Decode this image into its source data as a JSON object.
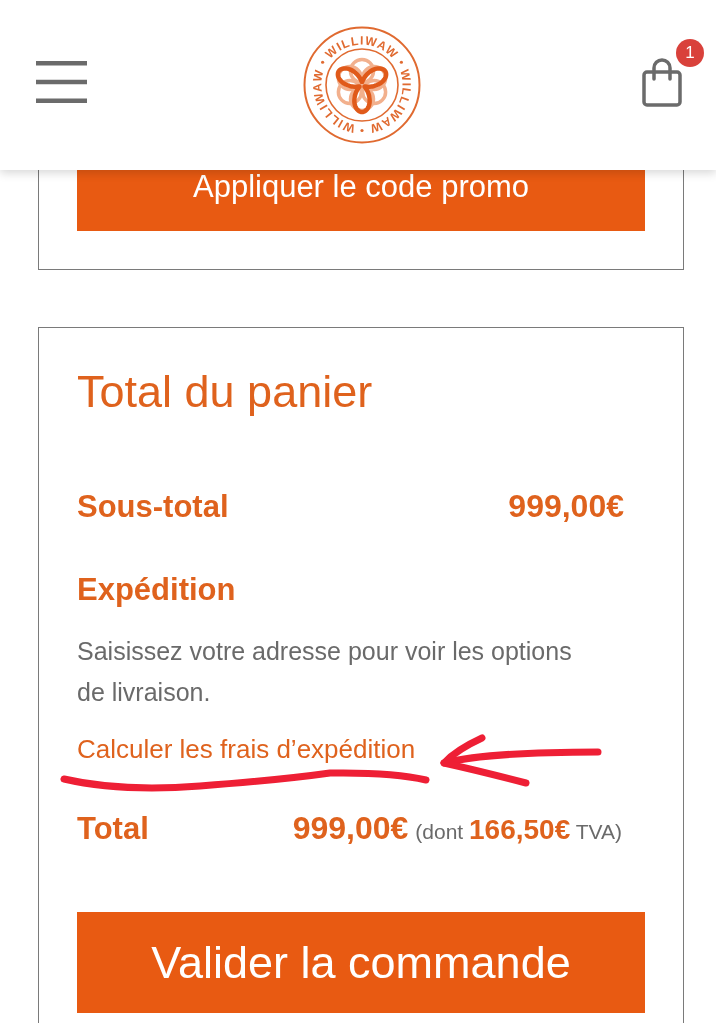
{
  "header": {
    "logo_ring_texts": [
      "WILLIWAW",
      "WILLIWAW",
      "WILLIWAW"
    ],
    "cart_count": "1"
  },
  "coupon": {
    "apply_button": "Appliquer le code promo"
  },
  "cart_totals": {
    "title": "Total du panier",
    "subtotal": {
      "label": "Sous-total",
      "value": "999,00€"
    },
    "shipping": {
      "label": "Expédition",
      "note": "Saisissez votre adresse pour voir les options de livraison.",
      "link": "Calculer les frais d’expédition"
    },
    "total": {
      "label": "Total",
      "value": "999,00€",
      "tax_note": "(dont **166,50€** TVA)"
    },
    "checkout_button": "Valider la commande"
  }
}
